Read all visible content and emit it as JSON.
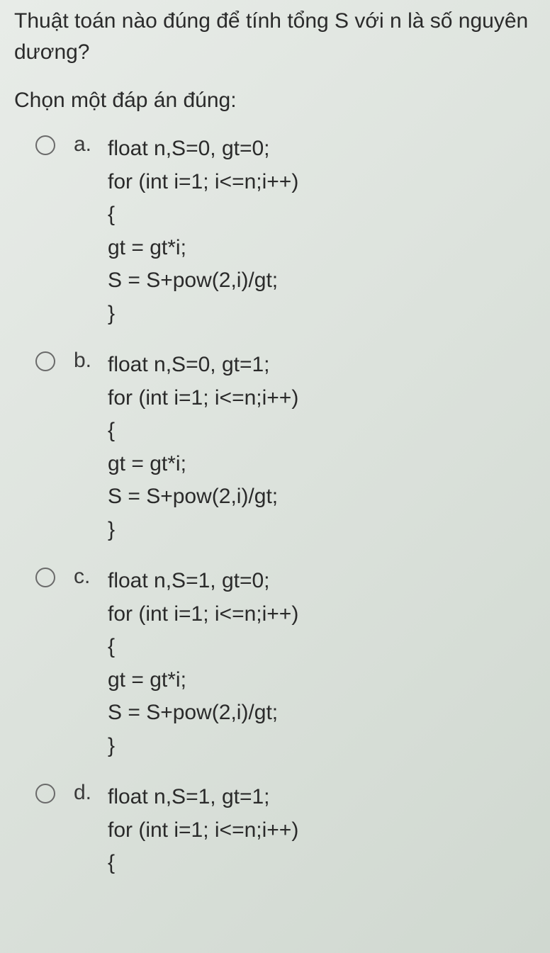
{
  "question": "Thuật toán nào đúng để tính tổng S với n là số nguyên dương?",
  "instruction": "Chọn một đáp án đúng:",
  "options": [
    {
      "letter": "a.",
      "code": "float n,S=0, gt=0;\nfor (int i=1; i<=n;i++)\n{\ngt = gt*i;\nS = S+pow(2,i)/gt;\n}"
    },
    {
      "letter": "b.",
      "code": "float n,S=0, gt=1;\nfor (int i=1; i<=n;i++)\n{\ngt = gt*i;\nS = S+pow(2,i)/gt;\n}"
    },
    {
      "letter": "c.",
      "code": "float n,S=1, gt=0;\nfor (int i=1; i<=n;i++)\n{\ngt = gt*i;\nS = S+pow(2,i)/gt;\n}"
    },
    {
      "letter": "d.",
      "code": "float n,S=1, gt=1;\nfor (int i=1; i<=n;i++)\n{"
    }
  ]
}
